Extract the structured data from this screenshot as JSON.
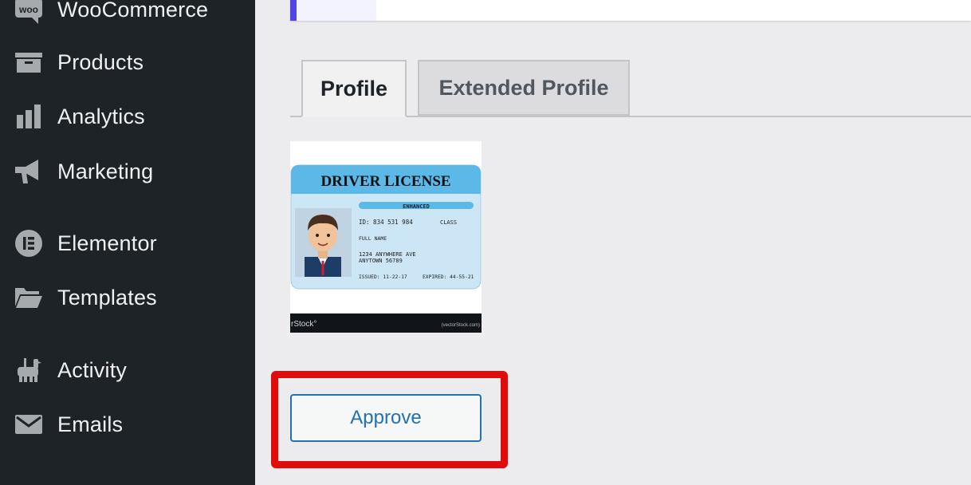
{
  "sidebar": {
    "items": [
      {
        "label": "WooCommerce",
        "icon": "woo-icon"
      },
      {
        "label": "Products",
        "icon": "archive-box-icon"
      },
      {
        "label": "Analytics",
        "icon": "bar-chart-icon"
      },
      {
        "label": "Marketing",
        "icon": "megaphone-icon"
      },
      {
        "label": "Elementor",
        "icon": "elementor-icon"
      },
      {
        "label": "Templates",
        "icon": "folder-icon"
      },
      {
        "label": "Activity",
        "icon": "activity-icon"
      },
      {
        "label": "Emails",
        "icon": "envelope-icon"
      }
    ]
  },
  "tabs": [
    {
      "label": "Profile",
      "active": true
    },
    {
      "label": "Extended Profile",
      "active": false
    }
  ],
  "id_card": {
    "title": "DRIVER LICENSE",
    "badge": "ENHANCED",
    "id_line": "ID: 834 531 984",
    "class_label": "CLASS",
    "name_label": "FULL NAME",
    "address_line1": "1234 ANYWHERE AVE",
    "address_line2": "ANYTOWN 56789",
    "issued": "ISSUED: 11-22-17",
    "expired": "EXPIRED: 44-55-21",
    "watermark_left": "rStock°",
    "watermark_right": "(vectorStock.com)"
  },
  "approve_label": "Approve",
  "colors": {
    "sidebar_bg": "#1d2327",
    "accent": "#4f46e5",
    "button_blue": "#2271b1",
    "highlight_red": "#e00b0b"
  }
}
